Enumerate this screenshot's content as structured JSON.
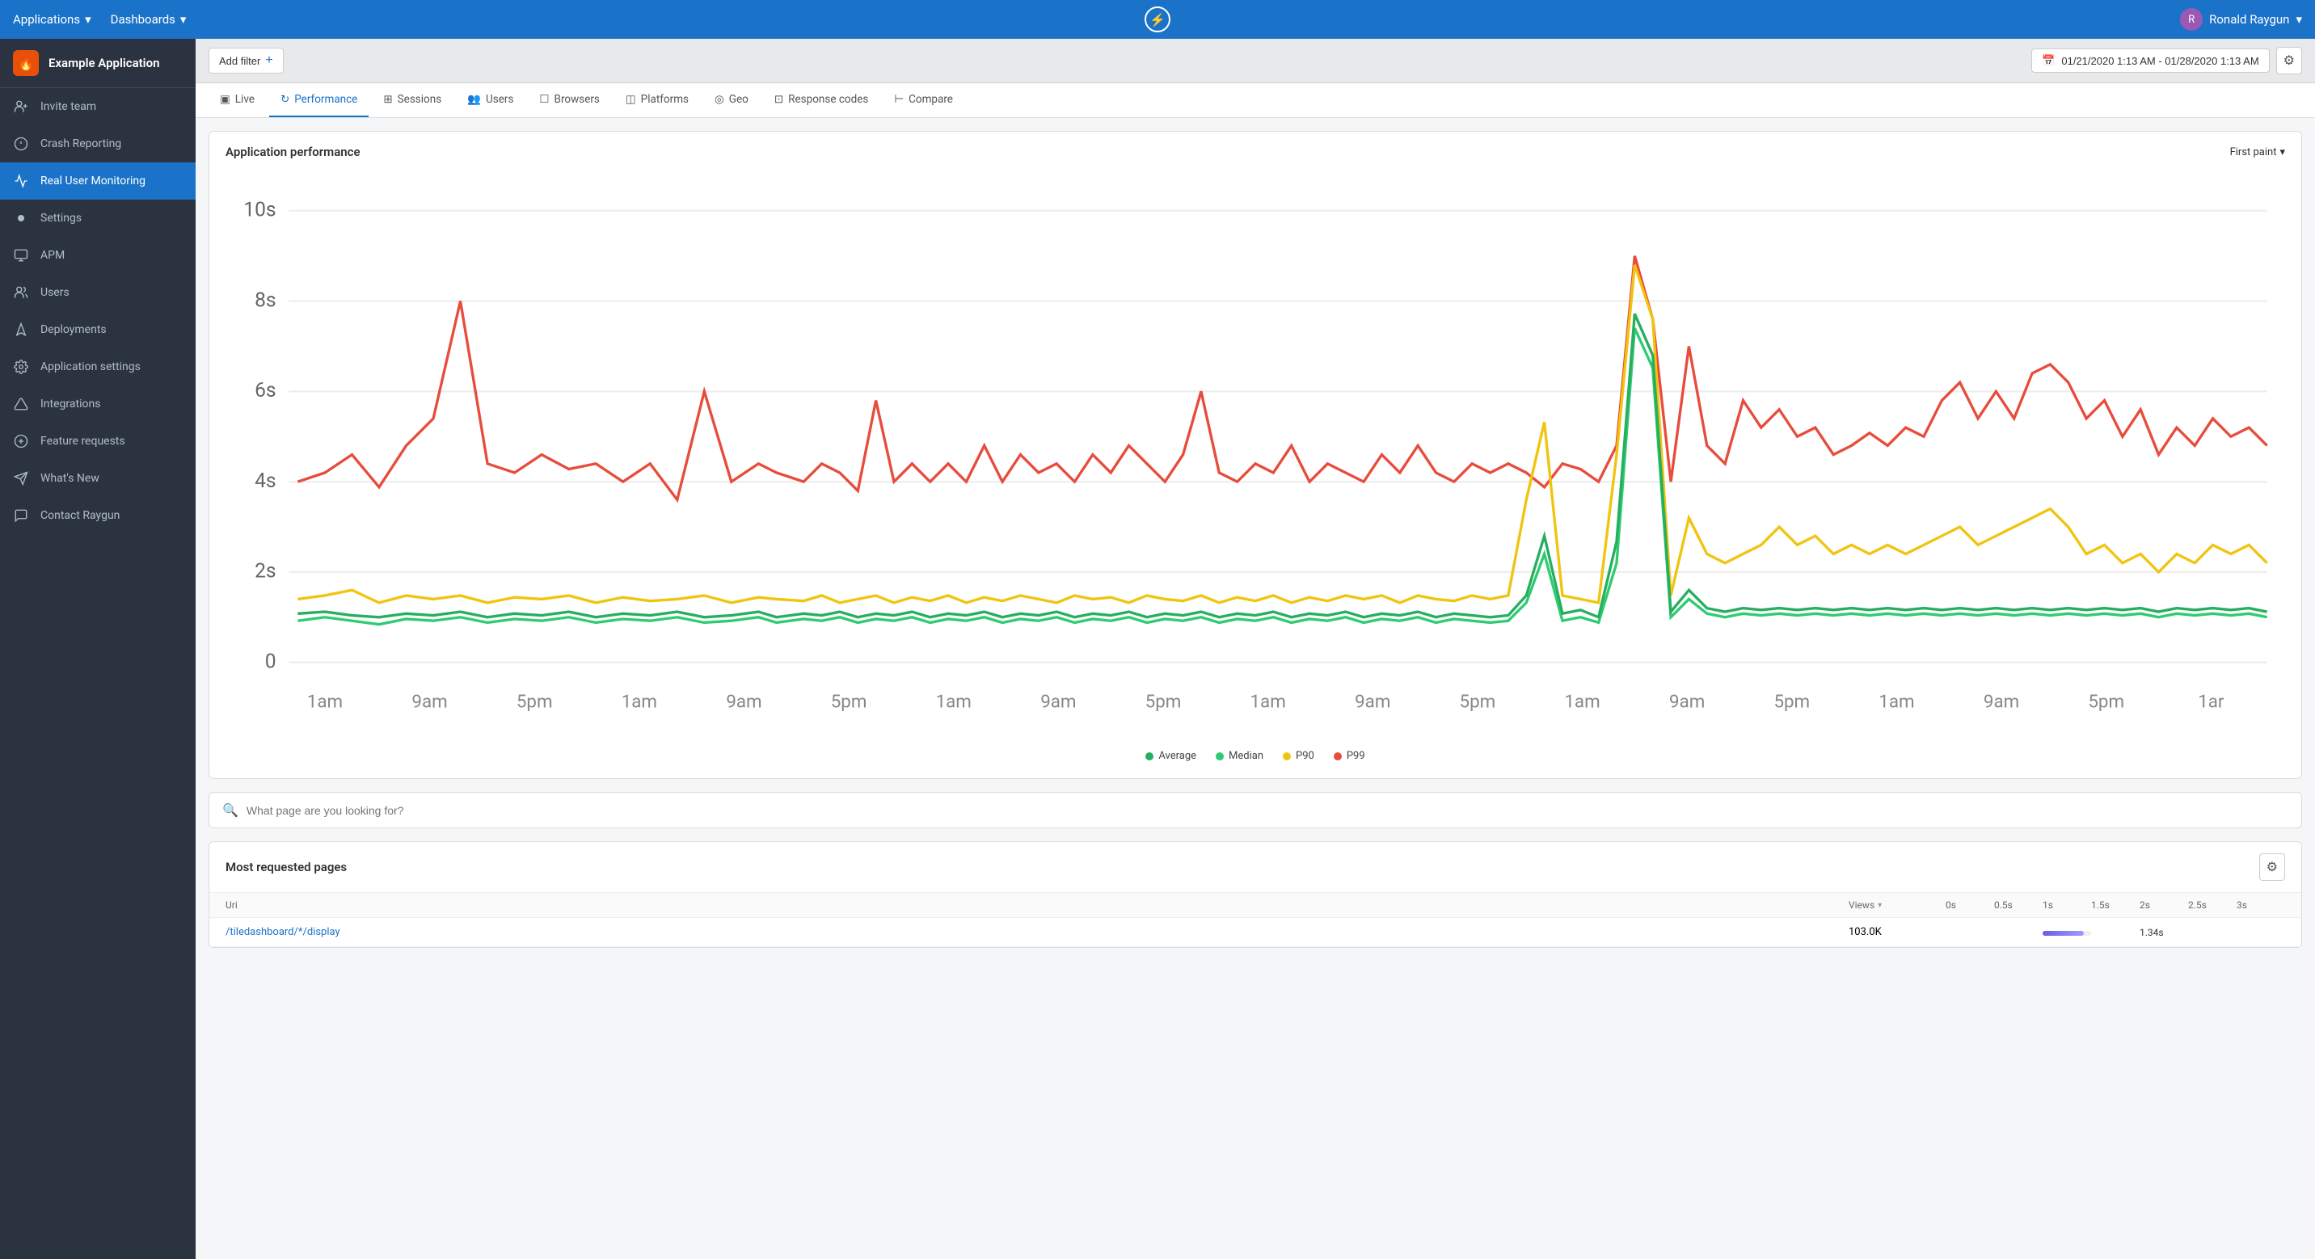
{
  "topNav": {
    "appLabel": "Applications",
    "dashboardsLabel": "Dashboards",
    "centerIcon": "⚡",
    "userName": "Ronald Raygun"
  },
  "sidebar": {
    "appName": "Example Application",
    "items": [
      {
        "id": "invite-team",
        "label": "Invite team",
        "icon": "invite"
      },
      {
        "id": "crash-reporting",
        "label": "Crash Reporting",
        "icon": "crash"
      },
      {
        "id": "real-user-monitoring",
        "label": "Real User Monitoring",
        "icon": "rum",
        "active": true
      },
      {
        "id": "settings",
        "label": "Settings",
        "icon": "dot"
      },
      {
        "id": "apm",
        "label": "APM",
        "icon": "apm"
      },
      {
        "id": "users",
        "label": "Users",
        "icon": "users"
      },
      {
        "id": "deployments",
        "label": "Deployments",
        "icon": "deployments"
      },
      {
        "id": "application-settings",
        "label": "Application settings",
        "icon": "appsettings"
      },
      {
        "id": "integrations",
        "label": "Integrations",
        "icon": "integrations"
      },
      {
        "id": "feature-requests",
        "label": "Feature requests",
        "icon": "featurerequests"
      },
      {
        "id": "whats-new",
        "label": "What's New",
        "icon": "whatsnew"
      },
      {
        "id": "contact-raygun",
        "label": "Contact Raygun",
        "icon": "contact"
      }
    ]
  },
  "filterBar": {
    "addFilterLabel": "Add filter",
    "plusIcon": "+",
    "dateRange": "01/21/2020 1:13 AM - 01/28/2020 1:13 AM",
    "gearIcon": "⚙"
  },
  "tabs": [
    {
      "id": "live",
      "label": "Live",
      "icon": "live"
    },
    {
      "id": "performance",
      "label": "Performance",
      "icon": "performance",
      "active": true
    },
    {
      "id": "sessions",
      "label": "Sessions",
      "icon": "sessions"
    },
    {
      "id": "users",
      "label": "Users",
      "icon": "users"
    },
    {
      "id": "browsers",
      "label": "Browsers",
      "icon": "browsers"
    },
    {
      "id": "platforms",
      "label": "Platforms",
      "icon": "platforms"
    },
    {
      "id": "geo",
      "label": "Geo",
      "icon": "geo"
    },
    {
      "id": "response-codes",
      "label": "Response codes",
      "icon": "responsecodes"
    },
    {
      "id": "compare",
      "label": "Compare",
      "icon": "compare"
    }
  ],
  "chart": {
    "title": "Application performance",
    "metricLabel": "First paint",
    "yAxisLabels": [
      "10s",
      "8s",
      "6s",
      "4s",
      "2s",
      "0"
    ],
    "xAxisLabels": [
      "1am",
      "9am",
      "5pm",
      "1am",
      "9am",
      "5pm",
      "1am",
      "9am",
      "5pm",
      "1am",
      "9am",
      "5pm",
      "1am",
      "9am",
      "5pm",
      "1am",
      "9am",
      "5pm",
      "1am",
      "9am",
      "5pm",
      "1ar"
    ],
    "legend": [
      {
        "label": "Average",
        "color": "#27ae60"
      },
      {
        "label": "Median",
        "color": "#2ecc71"
      },
      {
        "label": "P90",
        "color": "#f1c40f"
      },
      {
        "label": "P99",
        "color": "#e74c3c"
      }
    ]
  },
  "searchBar": {
    "placeholder": "What page are you looking for?"
  },
  "pagesTable": {
    "title": "Most requested pages",
    "gearIcon": "⚙",
    "columns": [
      "Uri",
      "Views",
      "0s",
      "0.5s",
      "1s",
      "1.5s",
      "2s",
      "2.5s",
      "3s"
    ],
    "rows": [
      {
        "uri": "/tiledashboard/*/display",
        "views": "103.0K",
        "barWidth": 85
      }
    ]
  }
}
